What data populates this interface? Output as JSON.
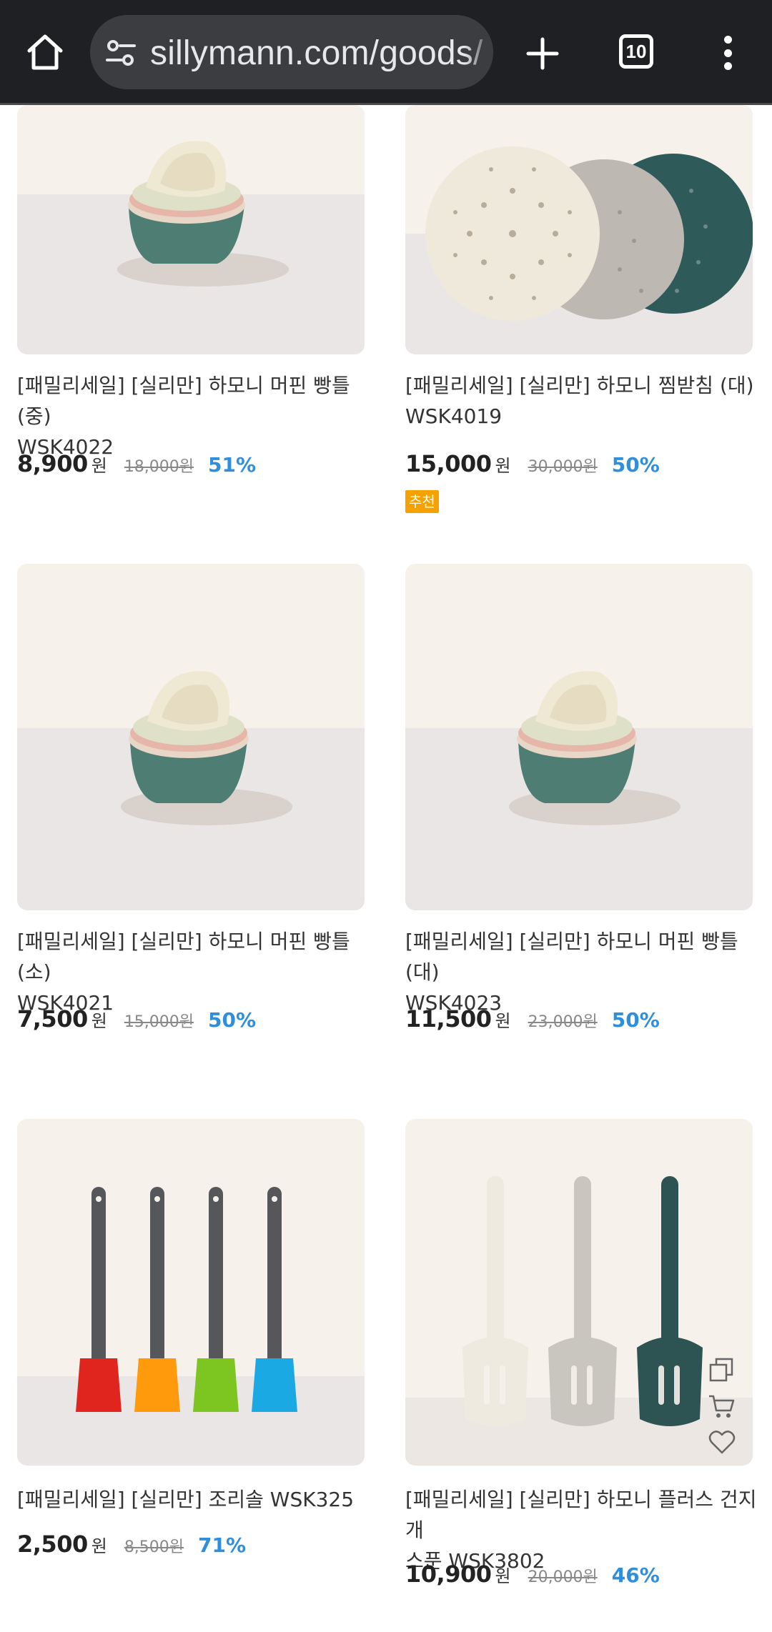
{
  "browser": {
    "url": "sillymann.com/goods/",
    "tab_count": "10",
    "home_icon": "home-icon",
    "site_info_icon": "tune-icon",
    "new_tab_icon": "plus-icon",
    "menu_icon": "more-vert-icon"
  },
  "products": [
    {
      "name_line1": "[패밀리세일] [실리만] 하모니 머핀 빵틀(중)",
      "name_line2": "WSK4022",
      "price": "8,900",
      "currency": "원",
      "original_price": "18,000원",
      "discount": "51%",
      "badge": ""
    },
    {
      "name_line1": "[패밀리세일] [실리만] 하모니 찜받침 (대)",
      "name_line2": "WSK4019",
      "price": "15,000",
      "currency": "원",
      "original_price": "30,000원",
      "discount": "50%",
      "badge": "추천"
    },
    {
      "name_line1": "[패밀리세일] [실리만] 하모니 머핀 빵틀 (소)",
      "name_line2": "WSK4021",
      "price": "7,500",
      "currency": "원",
      "original_price": "15,000원",
      "discount": "50%",
      "badge": ""
    },
    {
      "name_line1": "[패밀리세일] [실리만] 하모니 머핀 빵틀 (대)",
      "name_line2": "WSK4023",
      "price": "11,500",
      "currency": "원",
      "original_price": "23,000원",
      "discount": "50%",
      "badge": ""
    },
    {
      "name_line1": "[패밀리세일] [실리만] 조리솔 WSK325",
      "name_line2": "",
      "price": "2,500",
      "currency": "원",
      "original_price": "8,500원",
      "discount": "71%",
      "badge": ""
    },
    {
      "name_line1": "[패밀리세일] [실리만] 하모니 플러스 건지개",
      "name_line2": "스푼 WSK3802",
      "price": "10,900",
      "currency": "원",
      "original_price": "20,000원",
      "discount": "46%",
      "badge": ""
    }
  ],
  "quick_actions": [
    "copy-icon",
    "cart-icon",
    "heart-icon"
  ],
  "colors": {
    "discount": "#2f8fdc",
    "badge": "#f5a200",
    "chrome": "#1f2023"
  }
}
